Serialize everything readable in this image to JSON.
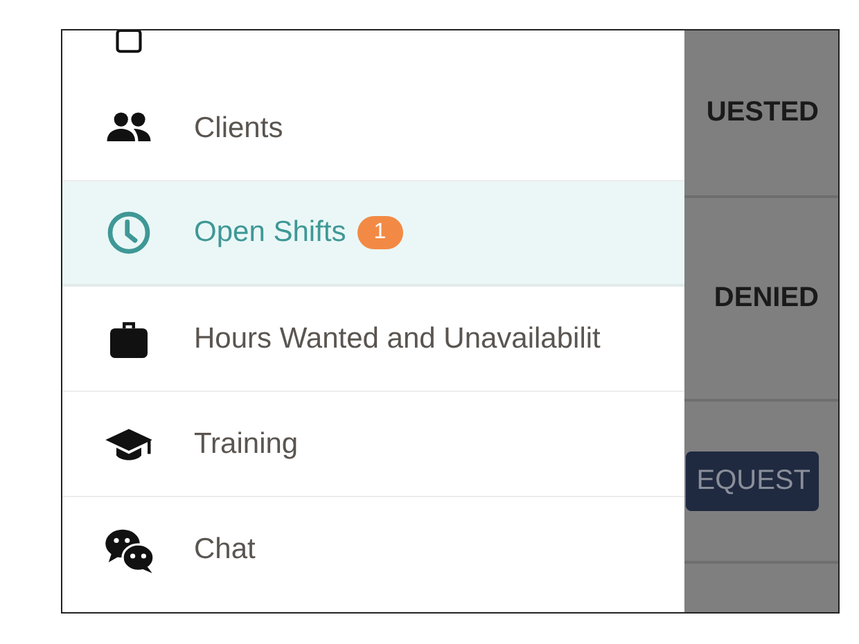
{
  "background_rows": [
    {
      "kind": "status",
      "text": "UESTED"
    },
    {
      "kind": "status",
      "text": "DENIED"
    },
    {
      "kind": "button",
      "text": "EQUEST"
    },
    {
      "kind": "empty"
    }
  ],
  "drawer": {
    "items": [
      {
        "selected": false
      },
      {
        "label": "Clients",
        "selected": false
      },
      {
        "label": "Open Shifts",
        "badge": "1",
        "selected": true
      },
      {
        "label": "Hours Wanted and Unavailabilit",
        "selected": false
      },
      {
        "label": "Training",
        "selected": false
      },
      {
        "label": "Chat",
        "selected": false
      }
    ]
  }
}
